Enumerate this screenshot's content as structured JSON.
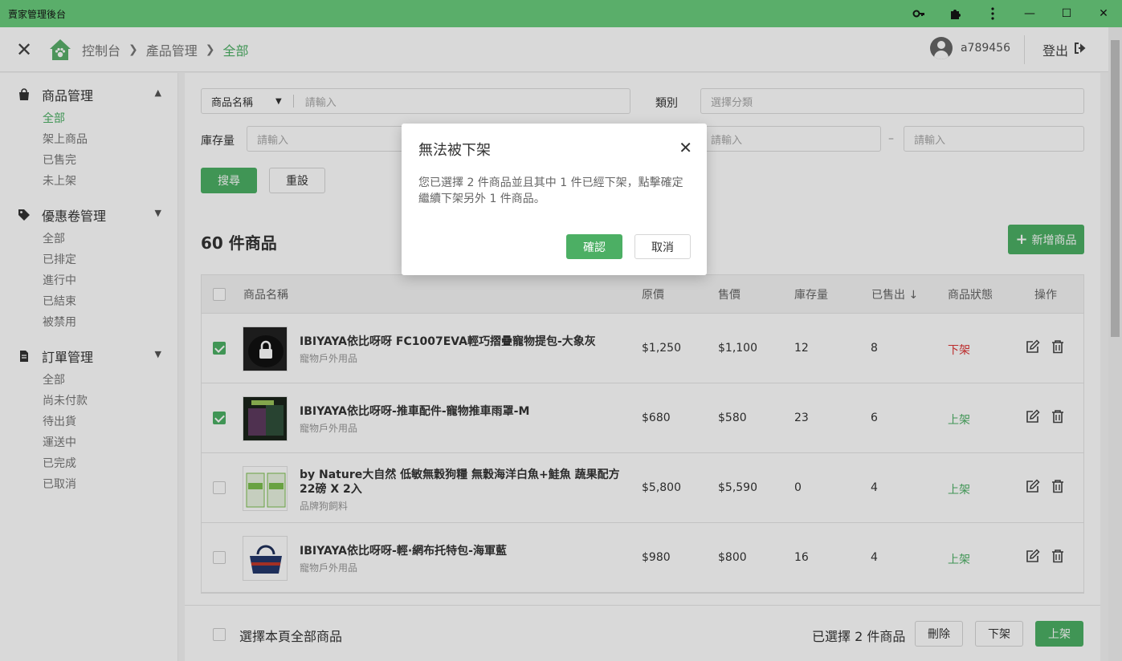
{
  "window": {
    "title": "賣家管理後台",
    "controls": {
      "minimize": "—",
      "maximize": "☐",
      "close": "✕"
    }
  },
  "header": {
    "breadcrumb": [
      "控制台",
      "產品管理",
      "全部"
    ],
    "username": "a789456",
    "logout": "登出"
  },
  "sidebar": {
    "sections": [
      {
        "label": "商品管理",
        "items": [
          "全部",
          "架上商品",
          "已售完",
          "未上架"
        ],
        "active_item": 0,
        "expanded": true
      },
      {
        "label": "優惠卷管理",
        "items": [
          "全部",
          "已排定",
          "進行中",
          "已結束",
          "被禁用"
        ],
        "expanded": true
      },
      {
        "label": "訂單管理",
        "items": [
          "全部",
          "尚未付款",
          "待出貨",
          "運送中",
          "已完成",
          "已取消"
        ],
        "expanded": true
      }
    ]
  },
  "filters": {
    "name_select": "商品名稱",
    "name_placeholder": "請輸入",
    "category_label": "類別",
    "category_placeholder": "選擇分類",
    "stock_label": "庫存量",
    "stock_min_placeholder": "請輸入",
    "price_min_placeholder": "請輸入",
    "range_dash": "–",
    "price_max_placeholder": "請輸入",
    "search_button": "搜尋",
    "reset_button": "重設"
  },
  "product_count": "60 件商品",
  "add_button": "新增商品",
  "table": {
    "columns": [
      "商品名稱",
      "原價",
      "售價",
      "庫存量",
      "已售出 ↓",
      "商品狀態",
      "操作"
    ],
    "rows": [
      {
        "name": "IBIYAYA依比呀呀 FC1007EVA輕巧摺疊寵物提包-大象灰",
        "category": "寵物戶外用品",
        "original_price": "$1,250",
        "price": "$1,100",
        "stock": "12",
        "sold": "8",
        "status": "下架",
        "checked": true
      },
      {
        "name": "IBIYAYA依比呀呀-推車配件-寵物推車雨罩-M",
        "category": "寵物戶外用品",
        "original_price": "$680",
        "price": "$580",
        "stock": "23",
        "sold": "6",
        "status": "上架",
        "checked": true
      },
      {
        "name": "by Nature大自然 低敏無穀狗糧 無穀海洋白魚+鮭魚 蔬果配方 22磅 X 2入",
        "category": "品牌狗飼料",
        "original_price": "$5,800",
        "price": "$5,590",
        "stock": "0",
        "sold": "4",
        "status": "上架",
        "checked": false
      },
      {
        "name": "IBIYAYA依比呀呀-輕·網布托特包-海軍藍",
        "category": "寵物戶外用品",
        "original_price": "$980",
        "price": "$800",
        "stock": "16",
        "sold": "4",
        "status": "上架",
        "checked": false
      }
    ]
  },
  "footer": {
    "select_all": "選擇本頁全部商品",
    "selected_text": "已選擇 2 件商品",
    "delete_button": "刪除",
    "unlist_button": "下架",
    "list_button": "上架"
  },
  "modal": {
    "title": "無法被下架",
    "body": "您已選擇 2 件商品並且其中 1 件已經下架，點擊確定繼續下架另外 1 件商品。",
    "confirm": "確認",
    "cancel": "取消"
  },
  "colors": {
    "accent": "#4caf64",
    "titlebar": "#5aae6a",
    "status_off": "#dd3333"
  },
  "icons": [
    "key-icon",
    "puzzle-icon",
    "more-vert-icon",
    "close-icon",
    "home-paw-icon",
    "chevron-right-icon",
    "avatar-icon",
    "logout-icon",
    "bag-icon",
    "tag-icon",
    "document-icon",
    "chevron-up-icon",
    "chevron-down-icon",
    "plus-icon",
    "edit-icon",
    "trash-icon",
    "arrow-down-icon"
  ]
}
